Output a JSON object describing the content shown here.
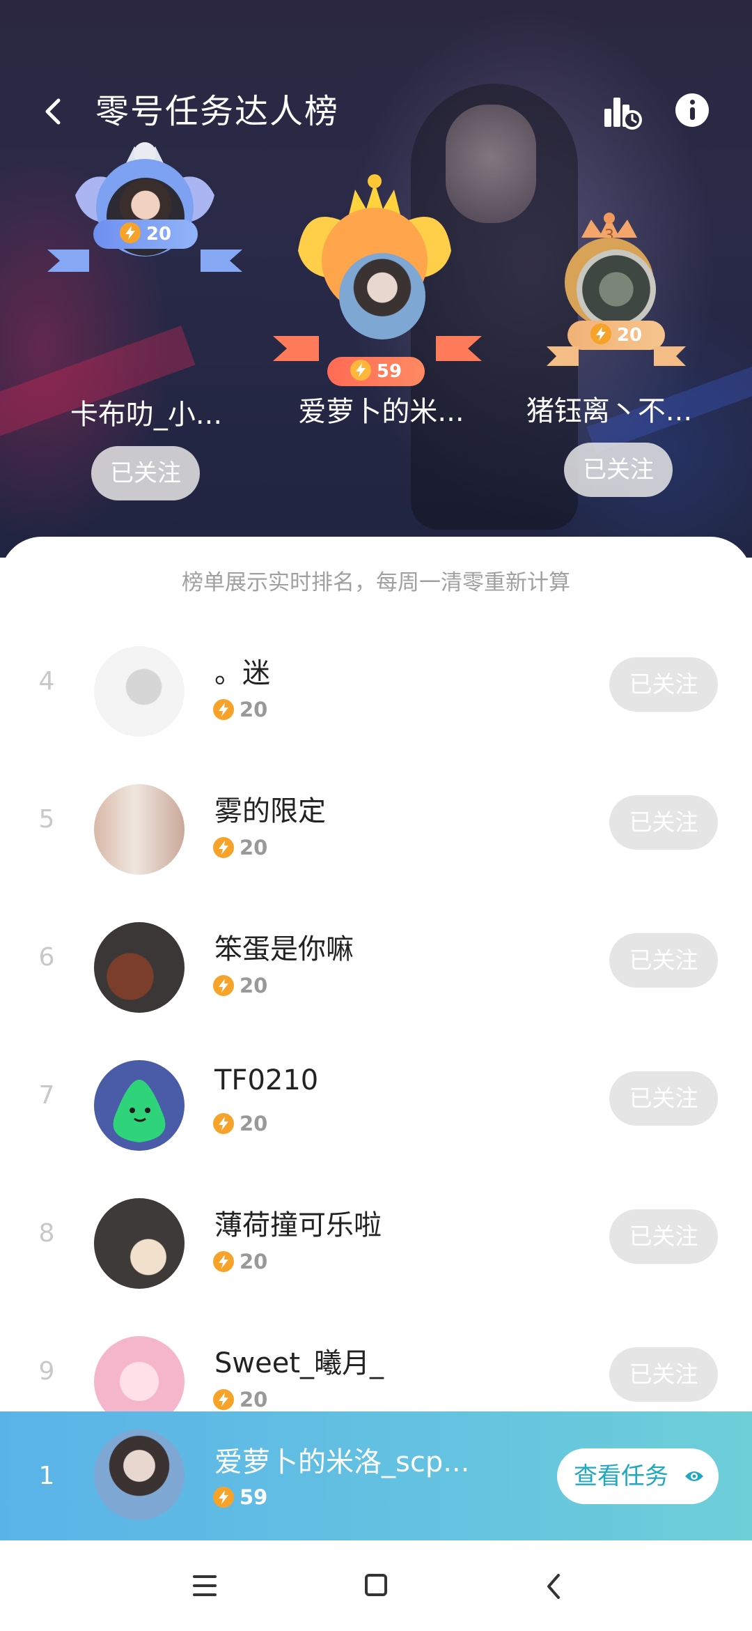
{
  "header": {
    "title": "零号任务达人榜"
  },
  "podium": [
    {
      "rank": "2",
      "name": "卡布叻_小...",
      "score": "20",
      "follow_label": "已关注",
      "medal": "silver"
    },
    {
      "rank": "1",
      "name": "爱萝卜的米...",
      "score": "59",
      "follow_label": "",
      "medal": "gold"
    },
    {
      "rank": "3",
      "name": "猪钰离丶不...",
      "score": "20",
      "follow_label": "已关注",
      "medal": "bronze"
    }
  ],
  "notice": "榜单展示实时排名，每周一清零重新计算",
  "list": [
    {
      "rank": "4",
      "name": "。迷",
      "score": "20",
      "follow_label": "已关注"
    },
    {
      "rank": "5",
      "name": "雾的限定",
      "score": "20",
      "follow_label": "已关注"
    },
    {
      "rank": "6",
      "name": "笨蛋是你嘛",
      "score": "20",
      "follow_label": "已关注"
    },
    {
      "rank": "7",
      "name": "TF0210",
      "score": "20",
      "follow_label": "已关注"
    },
    {
      "rank": "8",
      "name": "薄荷撞可乐啦",
      "score": "20",
      "follow_label": "已关注"
    },
    {
      "rank": "9",
      "name": "Sweet_曦月_",
      "score": "20",
      "follow_label": "已关注"
    }
  ],
  "me": {
    "rank": "1",
    "name": "爱萝卜的米洛_scp...",
    "score": "59",
    "view_task_label": "查看任务"
  },
  "icons": {
    "back": "chevron-left-icon",
    "stats": "leaderboard-history-icon",
    "info": "info-icon",
    "score": "lightning-bolt-icon",
    "eye": "eye-icon"
  },
  "colors": {
    "score_badge": "#f7a32a",
    "my_bar_start": "#5ab3e8",
    "my_bar_end": "#6ecfd8",
    "view_task_text": "#20a8c0"
  }
}
